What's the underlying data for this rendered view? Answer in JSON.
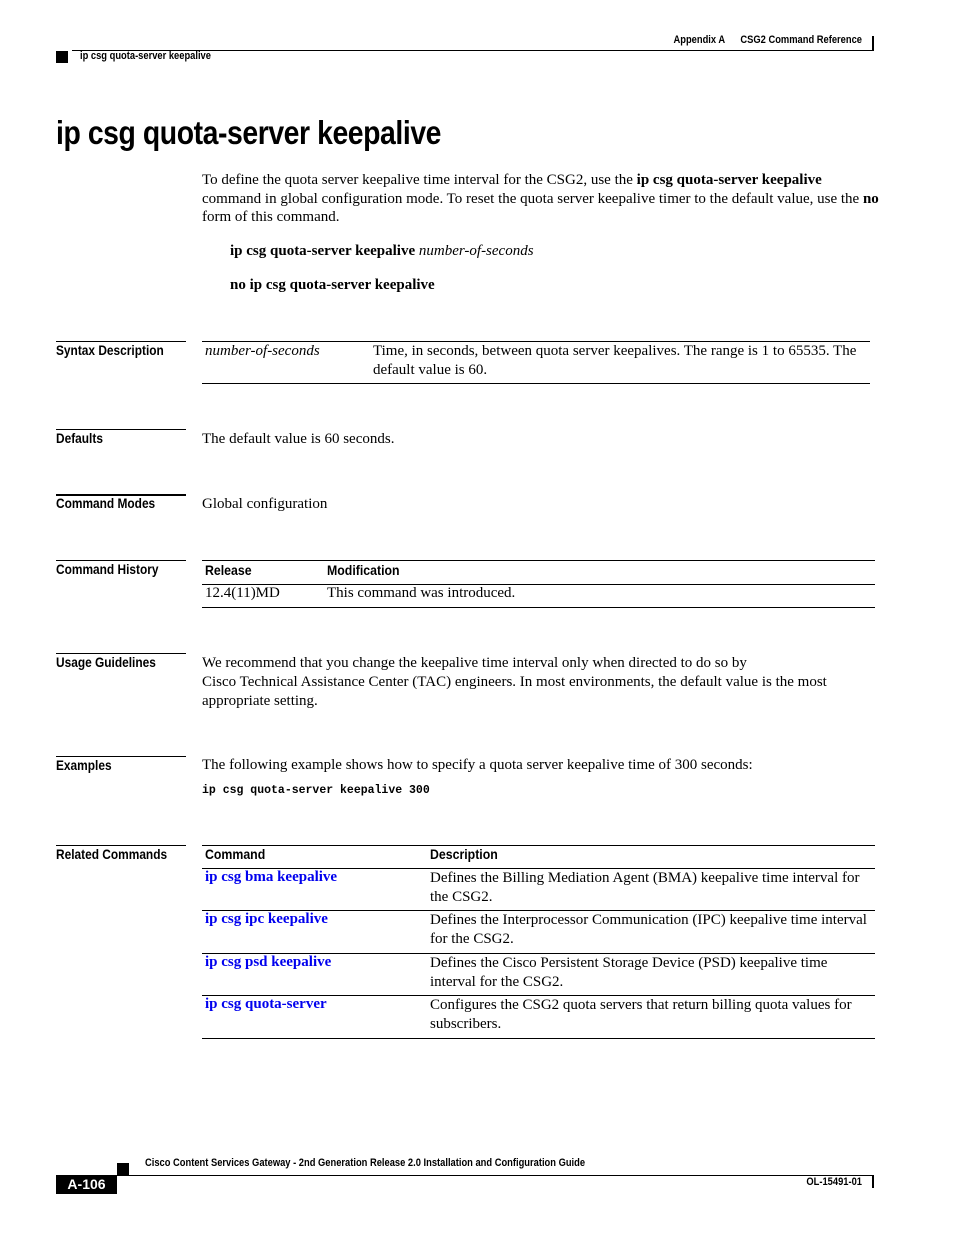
{
  "header": {
    "appendix": "Appendix A",
    "chapter": "CSG2 Command Reference",
    "running_title": "ip csg quota-server keepalive"
  },
  "title": "ip csg quota-server keepalive",
  "intro": {
    "part1": "To define the quota server keepalive time interval for the CSG2, use the ",
    "cmd": "ip csg quota-server keepalive",
    "part2": " command in global configuration mode. To reset the quota server keepalive timer to the default value, use the ",
    "no": "no",
    "part3": " form of this command."
  },
  "syntax": {
    "line1_cmd": "ip csg quota-server keepalive",
    "line1_arg": "number-of-seconds",
    "line2_cmd": "no ip csg quota-server keepalive"
  },
  "sections": {
    "syntax_description": {
      "label": "Syntax Description",
      "rows": [
        {
          "param": "number-of-seconds",
          "desc": "Time, in seconds, between quota server keepalives. The range is 1 to 65535. The default value is 60."
        }
      ]
    },
    "defaults": {
      "label": "Defaults",
      "text": "The default value is 60 seconds."
    },
    "command_modes": {
      "label": "Command Modes",
      "text": "Global configuration"
    },
    "command_history": {
      "label": "Command History",
      "headers": [
        "Release",
        "Modification"
      ],
      "rows": [
        {
          "release": "12.4(11)MD",
          "modification": "This command was introduced."
        }
      ]
    },
    "usage_guidelines": {
      "label": "Usage Guidelines",
      "line1": "We recommend that you change the keepalive time interval only when directed to do so by",
      "line2": "Cisco Technical Assistance Center (TAC) engineers. In most environments, the default value is the most appropriate setting."
    },
    "examples": {
      "label": "Examples",
      "text": "The following example shows how to specify a quota server keepalive time of 300 seconds:",
      "code": "ip csg quota-server keepalive 300"
    },
    "related_commands": {
      "label": "Related Commands",
      "headers": [
        "Command",
        "Description"
      ],
      "rows": [
        {
          "command": "ip csg bma keepalive",
          "description": "Defines the Billing Mediation Agent (BMA) keepalive time interval for the CSG2."
        },
        {
          "command": "ip csg ipc keepalive",
          "description": "Defines the Interprocessor Communication (IPC) keepalive time interval for the CSG2."
        },
        {
          "command": "ip csg psd keepalive",
          "description": "Defines the Cisco Persistent Storage Device (PSD) keepalive time interval for the CSG2."
        },
        {
          "command": "ip csg quota-server",
          "description": "Configures the CSG2 quota servers that return billing quota values for subscribers."
        }
      ]
    }
  },
  "footer": {
    "guide_title": "Cisco Content Services Gateway - 2nd Generation Release 2.0 Installation and Configuration Guide",
    "page_number": "A-106",
    "doc_number": "OL-15491-01"
  },
  "colors": {
    "link": "#0000ee",
    "text": "#000000"
  }
}
